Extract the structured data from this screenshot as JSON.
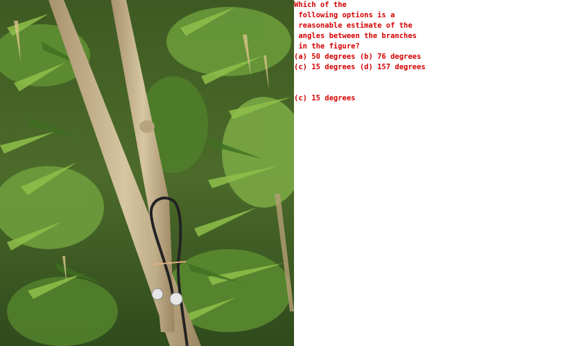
{
  "question": {
    "line1": "Which of the",
    "line2": " following options is a",
    "line3": " reasonable estimate of the",
    "line4": " angles between the branches",
    "line5": " in the figure?",
    "options_line1": "(a) 50 degrees (b) 76 degrees",
    "options_line2": "(c) 15 degrees (d) 157 degrees"
  },
  "answer": {
    "text": "(c) 15 degrees"
  },
  "colors": {
    "text": "#d40000",
    "leaf_green": "#4f8a2a",
    "bamboo_stalk": "#c8b48e"
  }
}
